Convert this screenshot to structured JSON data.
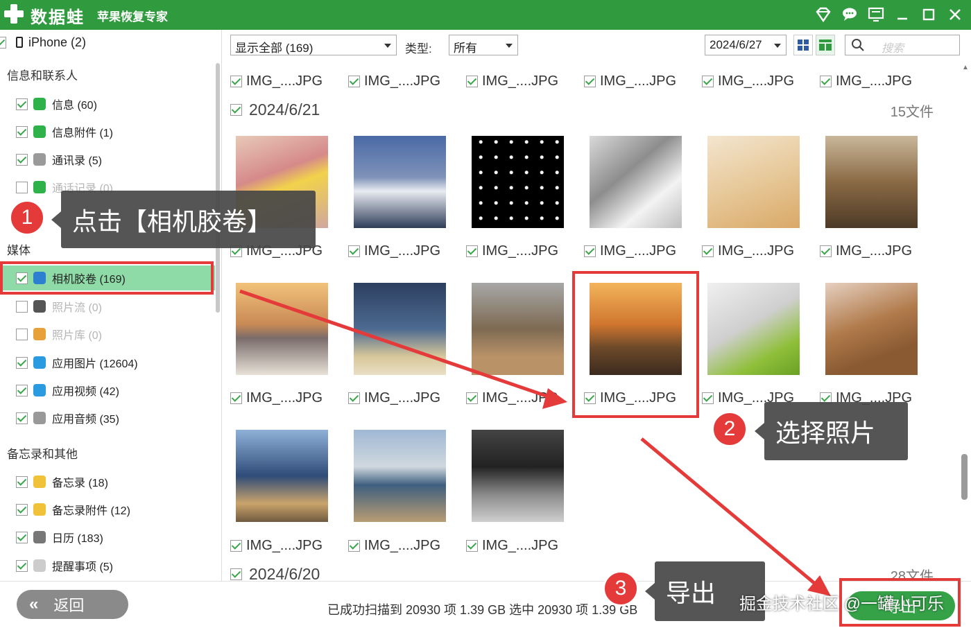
{
  "titlebar": {
    "app_name": "数据蛙",
    "app_sub": "苹果恢复专家",
    "icons": [
      "diamond-icon",
      "chat-icon",
      "monitor-icon",
      "minimize-icon",
      "maximize-icon",
      "close-icon"
    ]
  },
  "sidebar": {
    "device": "iPhone (2)",
    "sections": {
      "messages": "信息和联系人",
      "media": "媒体",
      "notes": "备忘录和其他"
    },
    "items": [
      {
        "label": "信息 (60)",
        "checked": true,
        "icon": "message-icon",
        "color": "#2fb24a"
      },
      {
        "label": "信息附件 (1)",
        "checked": true,
        "icon": "attachment-icon",
        "color": "#2fb24a"
      },
      {
        "label": "通讯录 (5)",
        "checked": true,
        "icon": "contacts-icon",
        "color": "#9a9a9a"
      },
      {
        "label": "通话记录 (0)",
        "checked": false,
        "icon": "phone-icon",
        "color": "#2fb24a"
      },
      {
        "label": "相机胶卷 (169)",
        "checked": true,
        "icon": "camera-icon",
        "color": "#2d7fd1"
      },
      {
        "label": "照片流 (0)",
        "checked": false,
        "icon": "photostream-icon",
        "color": "#555555"
      },
      {
        "label": "照片库 (0)",
        "checked": false,
        "icon": "photolibrary-icon",
        "color": "#e8a13a"
      },
      {
        "label": "应用图片 (12604)",
        "checked": true,
        "icon": "app-photo-icon",
        "color": "#2a9be0"
      },
      {
        "label": "应用视频 (42)",
        "checked": true,
        "icon": "app-video-icon",
        "color": "#2a9be0"
      },
      {
        "label": "应用音频 (35)",
        "checked": true,
        "icon": "music-note-icon",
        "color": "#999999"
      },
      {
        "label": "备忘录 (18)",
        "checked": true,
        "icon": "notes-icon",
        "color": "#f0c23a"
      },
      {
        "label": "备忘录附件 (12)",
        "checked": true,
        "icon": "notes-attachment-icon",
        "color": "#f0c23a"
      },
      {
        "label": "日历 (183)",
        "checked": true,
        "icon": "calendar-icon",
        "color": "#777777"
      },
      {
        "label": "提醒事项 (5)",
        "checked": true,
        "icon": "reminder-icon",
        "color": "#cccccc"
      }
    ]
  },
  "toolbar": {
    "filter": "显示全部 (169)",
    "type_label": "类型:",
    "type_value": "所有",
    "date": "2024/6/27",
    "search_placeholder": "搜索"
  },
  "grid": {
    "file_label": "IMG_....JPG",
    "group1_date": "2024/6/21",
    "group1_count": "15文件",
    "group2_date": "2024/6/20",
    "group2_count": "28文件"
  },
  "bottom": {
    "back": "返回",
    "status": "已成功扫描到 20930 项 1.39 GB  选中 20930 项 1.39 GB",
    "export": "导出"
  },
  "annotations": {
    "step1_num": "1",
    "step1_text": "点击【相机胶卷】",
    "step2_num": "2",
    "step2_text": "选择照片",
    "step3_num": "3",
    "step3_text": "导出",
    "watermark": "掘金技术社区 @一罐小可乐"
  }
}
